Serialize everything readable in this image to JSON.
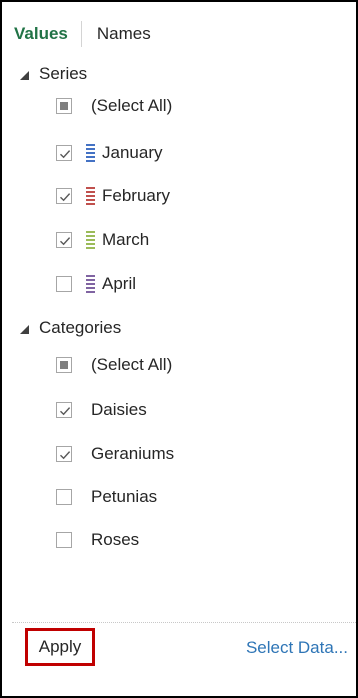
{
  "tabs": [
    {
      "label": "Values",
      "active": true
    },
    {
      "label": "Names",
      "active": false
    }
  ],
  "series": {
    "header": "Series",
    "select_all": {
      "label": "(Select All)",
      "state": "indeterminate"
    },
    "items": [
      {
        "label": "January",
        "checked": true,
        "color": "#4472c4"
      },
      {
        "label": "February",
        "checked": true,
        "color": "#c0504d"
      },
      {
        "label": "March",
        "checked": true,
        "color": "#9bbb59"
      },
      {
        "label": "April",
        "checked": false,
        "color": "#8064a2"
      }
    ]
  },
  "categories": {
    "header": "Categories",
    "select_all": {
      "label": "(Select All)",
      "state": "indeterminate"
    },
    "items": [
      {
        "label": "Daisies",
        "checked": true
      },
      {
        "label": "Geraniums",
        "checked": true
      },
      {
        "label": "Petunias",
        "checked": false
      },
      {
        "label": "Roses",
        "checked": false
      }
    ]
  },
  "footer": {
    "apply_label": "Apply",
    "select_data_label": "Select Data..."
  }
}
